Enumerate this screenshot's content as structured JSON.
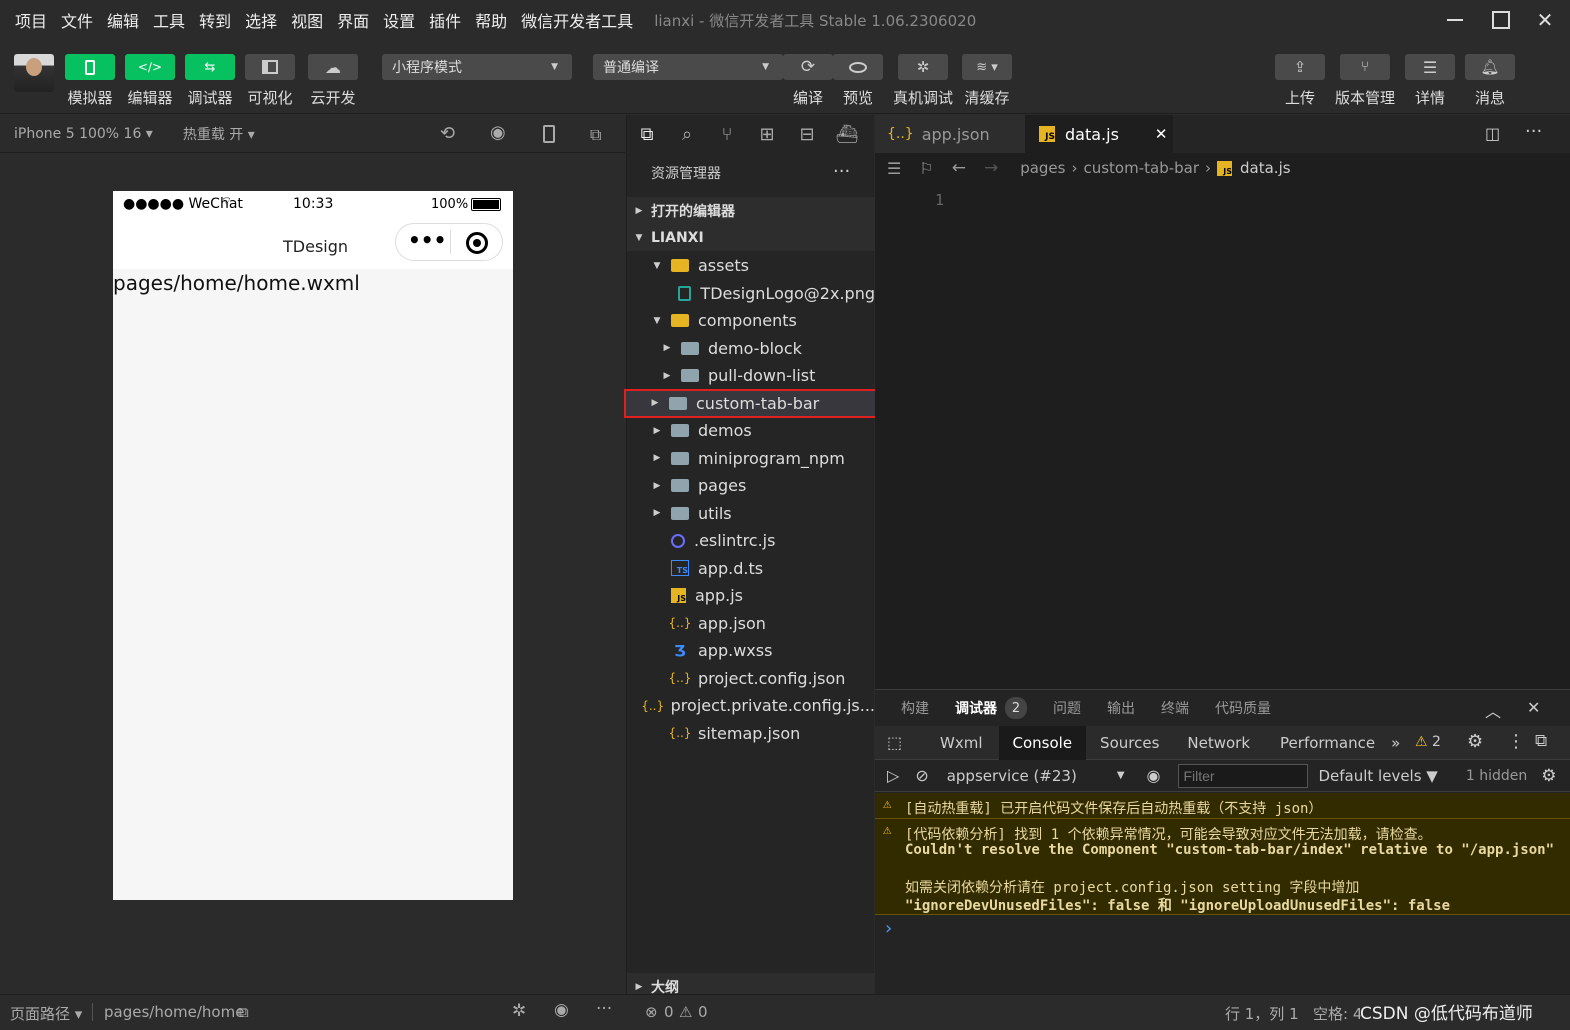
{
  "menubar": {
    "items": [
      "项目",
      "文件",
      "编辑",
      "工具",
      "转到",
      "选择",
      "视图",
      "界面",
      "设置",
      "插件",
      "帮助",
      "微信开发者工具"
    ],
    "window_title": "lianxi - 微信开发者工具 Stable 1.06.2306020"
  },
  "toolbar": {
    "simulator": "模拟器",
    "editor": "编辑器",
    "debugger": "调试器",
    "visual": "可视化",
    "cloud": "云开发",
    "mode_select": "小程序模式",
    "compile_select": "普通编译",
    "compile": "编译",
    "preview": "预览",
    "real_debug": "真机调试",
    "clear_cache": "清缓存",
    "upload": "上传",
    "version": "版本管理",
    "details": "详情",
    "messages": "消息"
  },
  "simulator": {
    "device": "iPhone 5 100% 16 ▾",
    "hot_reload": "热重载 开 ▾",
    "carrier": "●●●●● WeChat",
    "time": "10:33",
    "battery": "100%",
    "nav_title": "TDesign",
    "page_text": "pages/home/home.wxml"
  },
  "explorer": {
    "title": "资源管理器",
    "open_editors": "打开的编辑器",
    "project": "LIANXI",
    "outline": "大纲",
    "tree": [
      {
        "label": "assets",
        "type": "folder-open"
      },
      {
        "label": "TDesignLogo@2x.png",
        "type": "image"
      },
      {
        "label": "components",
        "type": "folder-open"
      },
      {
        "label": "demo-block",
        "type": "folder"
      },
      {
        "label": "pull-down-list",
        "type": "folder"
      },
      {
        "label": "custom-tab-bar",
        "type": "folder"
      },
      {
        "label": "demos",
        "type": "folder"
      },
      {
        "label": "miniprogram_npm",
        "type": "folder"
      },
      {
        "label": "pages",
        "type": "folder"
      },
      {
        "label": "utils",
        "type": "folder"
      },
      {
        "label": ".eslintrc.js",
        "type": "eslint"
      },
      {
        "label": "app.d.ts",
        "type": "ts"
      },
      {
        "label": "app.js",
        "type": "js"
      },
      {
        "label": "app.json",
        "type": "json"
      },
      {
        "label": "app.wxss",
        "type": "css"
      },
      {
        "label": "project.config.json",
        "type": "json"
      },
      {
        "label": "project.private.config.js...",
        "type": "json"
      },
      {
        "label": "sitemap.json",
        "type": "json"
      }
    ]
  },
  "editor": {
    "tabs": [
      {
        "label": "app.json"
      },
      {
        "label": "data.js",
        "active": true
      }
    ],
    "breadcrumb": [
      "pages",
      "custom-tab-bar",
      "data.js"
    ],
    "line_number": "1"
  },
  "panel": {
    "top_tabs": [
      "构建",
      "调试器",
      "问题",
      "输出",
      "终端",
      "代码质量"
    ],
    "debugger_badge": "2",
    "devtools_tabs": [
      "Wxml",
      "Console",
      "Sources",
      "Network",
      "Performance"
    ],
    "warning_count": "2",
    "context": "appservice (#23)",
    "filter_placeholder": "Filter",
    "levels": "Default levels ▼",
    "hidden": "1 hidden",
    "messages": [
      "[自动热重载] 已开启代码文件保存后自动热重载（不支持 json）",
      "[代码依赖分析] 找到 1 个依赖异常情况，可能会导致对应文件无法加载，请检查。",
      "Couldn't resolve the Component \"custom-tab-bar/index\" relative to \"/app.json\"",
      "如需关闭依赖分析请在 project.config.json setting 字段中增加",
      "\"ignoreDevUnusedFiles\": false 和 \"ignoreUploadUnusedFiles\": false"
    ],
    "prompt": "›"
  },
  "statusbar": {
    "page_path_label": "页面路径 ▾",
    "page_path": "pages/home/home",
    "errors": "0",
    "warnings": "0",
    "position": "行 1，列 1",
    "indent": "空格: 4",
    "watermark": "CSDN @低代码布道师"
  },
  "colors": {
    "accent_green": "#07c160",
    "highlight_red": "#e02020"
  }
}
